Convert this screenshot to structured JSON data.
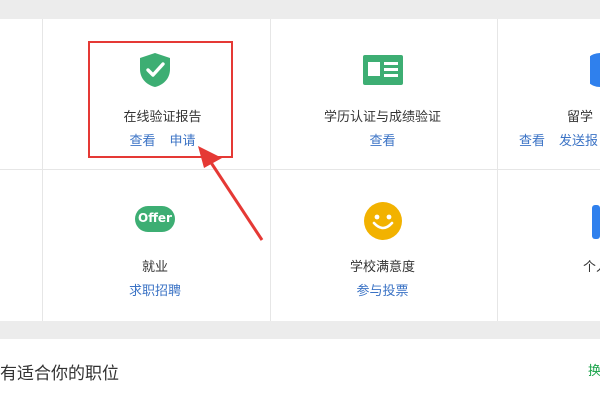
{
  "cells": [
    {
      "title": "在线验证报告",
      "links": [
        "查看",
        "申请"
      ]
    },
    {
      "title": "学历认证与成绩验证",
      "links": [
        "查看"
      ]
    },
    {
      "title": "留学",
      "links": [
        "查看",
        "发送报"
      ]
    },
    {
      "title": "就业",
      "links": [
        "求职招聘"
      ]
    },
    {
      "title": "学校满意度",
      "links": [
        "参与投票"
      ]
    },
    {
      "title": "个人",
      "links": []
    }
  ],
  "icons": {
    "offer_label": "Offer"
  },
  "bottom": {
    "title": "有适合你的职位",
    "right_text": "换"
  },
  "colors": {
    "accent_link": "#3b73c5",
    "green": "#3dae73",
    "smiley": "#f2b200",
    "highlight": "#e53935",
    "blue_partial": "#2f80ed"
  }
}
